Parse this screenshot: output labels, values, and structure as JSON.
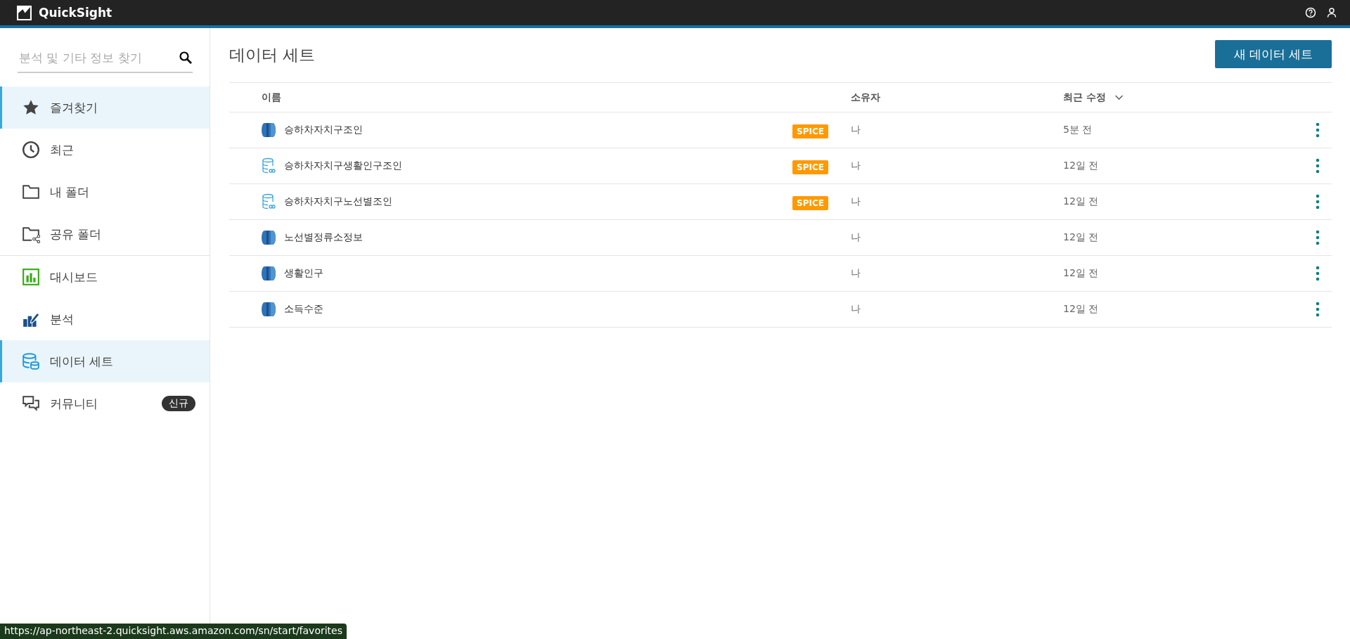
{
  "topbar": {
    "title": "QuickSight"
  },
  "sidebar": {
    "search": {
      "placeholder": "분석 및 기타 정보 찾기"
    },
    "groups": [
      [
        {
          "label": "즐겨찾기",
          "kind": "star",
          "selected": true
        },
        {
          "label": "최근",
          "kind": "clock",
          "selected": false
        },
        {
          "label": "내 폴더",
          "kind": "folder",
          "selected": false
        },
        {
          "label": "공유 폴더",
          "kind": "shared",
          "selected": false
        }
      ],
      [
        {
          "label": "대시보드",
          "kind": "dashboard",
          "selected": false
        },
        {
          "label": "분석",
          "kind": "analysis",
          "selected": false
        },
        {
          "label": "데이터 세트",
          "kind": "dataset",
          "selected": true
        },
        {
          "label": "커뮤니티",
          "kind": "community",
          "selected": false,
          "badge": "신규"
        }
      ]
    ]
  },
  "main": {
    "title": "데이터 세트",
    "new_button": "새 데이터 세트",
    "table": {
      "columns": [
        "이름",
        "소유자",
        "최근 수정"
      ],
      "rows": [
        {
          "kind": "database",
          "name": "승하차자치구조인",
          "tag": "SPICE",
          "owner": "나",
          "modified": "5분 전"
        },
        {
          "kind": "joined",
          "name": "승하차자치구생활인구조인",
          "tag": "SPICE",
          "owner": "나",
          "modified": "12일 전"
        },
        {
          "kind": "joined",
          "name": "승하차자치구노선별조인",
          "tag": "SPICE",
          "owner": "나",
          "modified": "12일 전"
        },
        {
          "kind": "database",
          "name": "노선별정류소정보",
          "owner": "나",
          "modified": "12일 전"
        },
        {
          "kind": "database",
          "name": "생활인구",
          "owner": "나",
          "modified": "12일 전"
        },
        {
          "kind": "database",
          "name": "소득수준",
          "owner": "나",
          "modified": "12일 전"
        }
      ]
    }
  },
  "status_bar": {
    "url": "https://ap-northeast-2.quicksight.aws.amazon.com/sn/start/favorites"
  }
}
